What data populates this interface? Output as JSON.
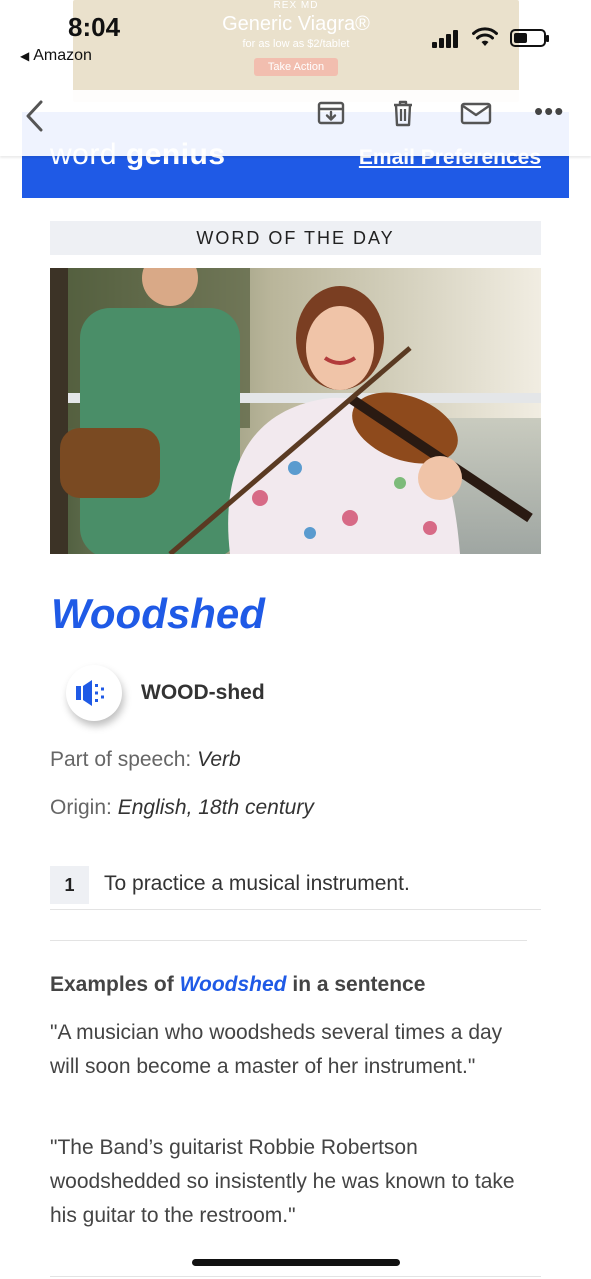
{
  "status_bar": {
    "time": "8:04",
    "back_app": "Amazon"
  },
  "ad": {
    "brand": "REX MD",
    "headline": "Generic Viagra®",
    "sub": "for as low as $2/tablet",
    "button": "Take Action"
  },
  "toolbar": {
    "more": "•••"
  },
  "header": {
    "logo_left": "word",
    "logo_right": "genius",
    "preferences_link": "Email Preferences",
    "color": "#1f5ae6"
  },
  "content": {
    "section_label": "WORD OF THE DAY",
    "word": "Woodshed",
    "pronunciation": "WOOD-shed",
    "part_of_speech_label": "Part of speech:",
    "part_of_speech": "Verb",
    "origin_label": "Origin:",
    "origin": "English, 18th century",
    "definitions": [
      {
        "number": "1",
        "text": "To practice a musical instrument."
      }
    ],
    "examples_heading_prefix": "Examples of",
    "examples_heading_word": "Woodshed",
    "examples_heading_suffix": "in a sentence",
    "examples": [
      "\"A musician who woodsheds several times a day will soon become a master of her instrument.\"",
      "\"The Band’s guitarist Robbie Robertson woodshedded so insistently he was known to take his guitar to the restroom.\""
    ]
  }
}
